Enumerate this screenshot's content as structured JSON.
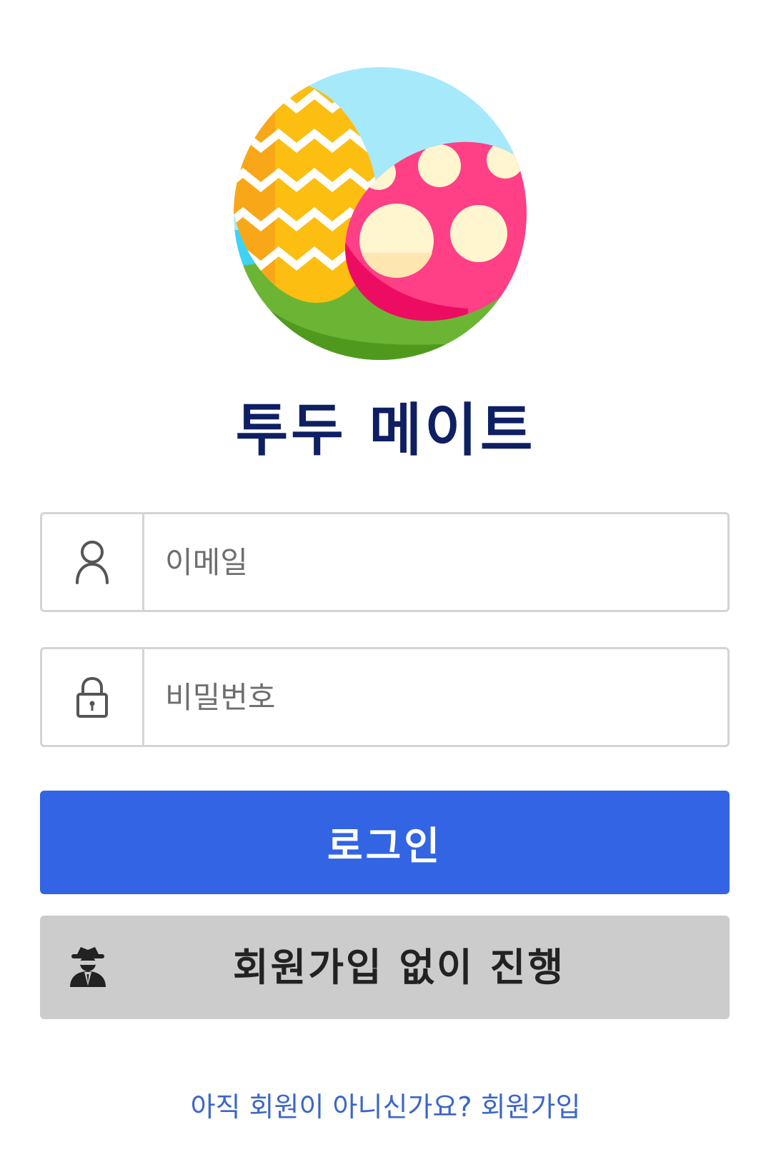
{
  "app": {
    "title": "투두 메이트"
  },
  "login_form": {
    "email": {
      "placeholder": "이메일",
      "icon": "user-icon"
    },
    "password": {
      "placeholder": "비밀번호",
      "icon": "lock-icon"
    },
    "login_button_label": "로그인",
    "guest_button": {
      "label": "회원가입 없이 진행",
      "icon": "incognito-agent-icon"
    }
  },
  "signup": {
    "prompt": "아직 회원이 아니신가요?",
    "link_label": "회원가입"
  },
  "colors": {
    "title": "#0e1f63",
    "login_button": "#3264e4",
    "guest_button": "#cccccc",
    "link": "#3a66c9"
  }
}
